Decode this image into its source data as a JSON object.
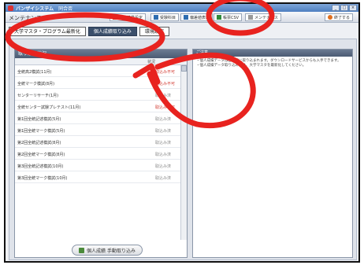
{
  "window": {
    "title": "バンザイシステム",
    "subtitle": "同合否",
    "controls": [
      "_",
      "□",
      "×"
    ]
  },
  "toolbar": {
    "menu_title": "メンテナンス",
    "buttons": [
      {
        "label": "判定基準設定",
        "icon": "settings-icon",
        "color": "#c0392b"
      },
      {
        "label": "受験科目",
        "icon": "book-icon",
        "color": "#2e6db0"
      },
      {
        "label": "偏差値表示",
        "icon": "chart-icon",
        "color": "#2e6db0"
      },
      {
        "label": "帳票CSV",
        "icon": "csv-icon",
        "color": "#2e8b3a"
      },
      {
        "label": "メンテナンス",
        "icon": "wrench-icon",
        "color": "#777777"
      }
    ],
    "exit_label": "終了する"
  },
  "tabs": [
    {
      "label": "大学マスタ・プログラム最新化",
      "active": false
    },
    {
      "label": "個人成績取り込み",
      "active": true
    },
    {
      "label": "環境設定",
      "active": false
    }
  ],
  "left_panel": {
    "header": "取り込み状況",
    "status_col": "状況",
    "rows": [
      {
        "name": "全統高2模試(11月)",
        "status": "取込み不可",
        "color": "#d2382f"
      },
      {
        "name": "全統マーク模試(8月)",
        "status": "取込み不可",
        "color": "#d2382f"
      },
      {
        "name": "センターリサーチ(1月)",
        "status": "取込み済",
        "color": "#888888"
      },
      {
        "name": "全統センター試験プレテスト(11月)",
        "status": "取込み不可",
        "color": "#d2382f"
      },
      {
        "name": "第1回全統記述模試(5月)",
        "status": "取込み済",
        "color": "#888888"
      },
      {
        "name": "第1回全統マーク模試(5月)",
        "status": "取込み済",
        "color": "#888888"
      },
      {
        "name": "第2回全統記述模試(8月)",
        "status": "取込み済",
        "color": "#888888"
      },
      {
        "name": "第2回全統マーク模試(8月)",
        "status": "取込み済",
        "color": "#888888"
      },
      {
        "name": "第3回全統記述模試(10月)",
        "status": "取込み済",
        "color": "#888888"
      },
      {
        "name": "第3回全統マーク模試(10月)",
        "status": "取込み済",
        "color": "#888888"
      }
    ],
    "import_button": "個人成績 手動取り込み"
  },
  "right_panel": {
    "header": "ご注意",
    "notes": [
      "・個人成績データは自動的に取り込まれます。ダウンロードサービスからも入手できます。",
      "・個人成績データ取り込み後は、大学マスタを最新化してください。"
    ]
  },
  "colors": {
    "accent_red": "#e8231f",
    "tab_active": "#3b4f6b",
    "panel_header": "#4a5a73"
  }
}
